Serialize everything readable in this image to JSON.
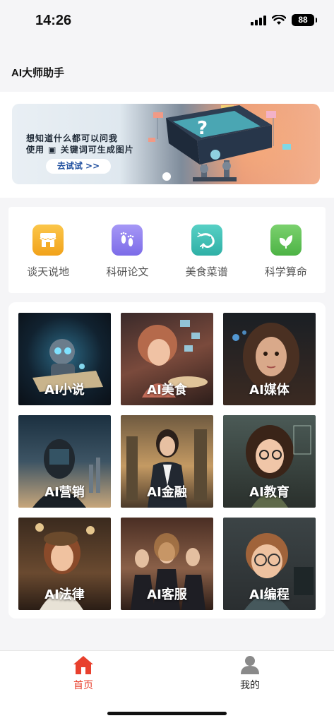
{
  "status": {
    "time": "14:26",
    "battery": "88"
  },
  "header": {
    "title": "AI大师助手"
  },
  "banner": {
    "line1": "想知道什么都可以问我",
    "line2": "使用 ▣ 关键词可生成图片",
    "button": "去试试 >>"
  },
  "categories": [
    {
      "label": "谈天说地",
      "icon": "storefront-icon",
      "color": "#f7b531"
    },
    {
      "label": "科研论文",
      "icon": "footprints-icon",
      "color": "#8f7ef0"
    },
    {
      "label": "美食菜谱",
      "icon": "shrimp-icon",
      "color": "#3fc0b6"
    },
    {
      "label": "科学算命",
      "icon": "leaf-icon",
      "color": "#5fc35a"
    }
  ],
  "tiles": [
    {
      "label": "AI小说",
      "icon": "robot-reading-image"
    },
    {
      "label": "AI美食",
      "icon": "girl-cooking-image"
    },
    {
      "label": "AI媒体",
      "icon": "girl-portrait-image"
    },
    {
      "label": "AI营销",
      "icon": "cyber-man-image"
    },
    {
      "label": "AI金融",
      "icon": "businesswoman-image"
    },
    {
      "label": "AI教育",
      "icon": "student-girl-image"
    },
    {
      "label": "AI法律",
      "icon": "girl-library-image"
    },
    {
      "label": "AI客服",
      "icon": "service-team-image"
    },
    {
      "label": "AI编程",
      "icon": "boy-glasses-image"
    }
  ],
  "tabbar": {
    "home": {
      "label": "首页",
      "active_color": "#e8402d"
    },
    "mine": {
      "label": "我的"
    }
  }
}
